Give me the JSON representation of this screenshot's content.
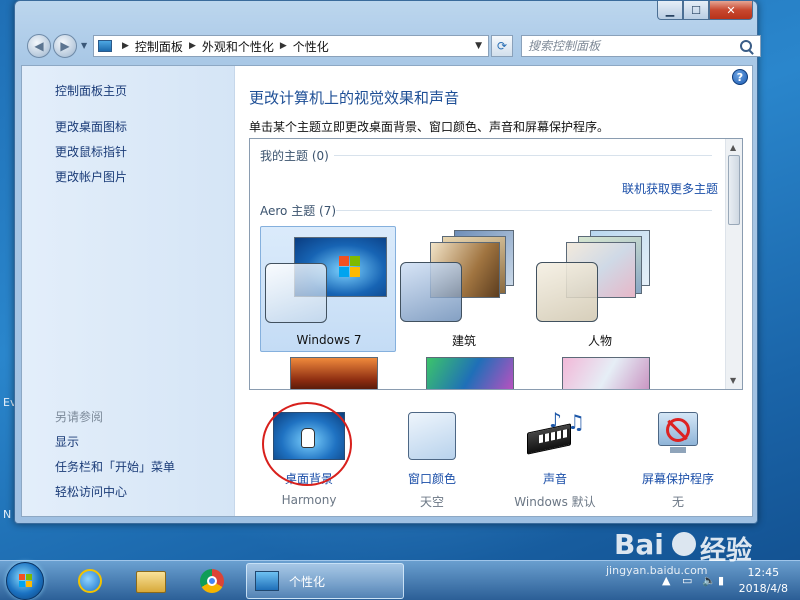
{
  "window": {
    "caption_buttons": {
      "minimize": "▁",
      "maximize": "☐",
      "close": "✕"
    }
  },
  "navbar": {
    "breadcrumbs": [
      "控制面板",
      "外观和个性化",
      "个性化"
    ],
    "search_placeholder": "搜索控制面板"
  },
  "sidebar": {
    "home": "控制面板主页",
    "links": [
      "更改桌面图标",
      "更改鼠标指针",
      "更改帐户图片"
    ],
    "see_also_title": "另请参阅",
    "see_also": [
      "显示",
      "任务栏和「开始」菜单",
      "轻松访问中心"
    ]
  },
  "main": {
    "title": "更改计算机上的视觉效果和声音",
    "description": "单击某个主题立即更改桌面背景、窗口颜色、声音和屏幕保护程序。",
    "my_themes": "我的主题 (0)",
    "more_themes_link": "联机获取更多主题",
    "aero_themes": "Aero 主题 (7)",
    "themes": [
      {
        "label": "Windows 7",
        "selected": true
      },
      {
        "label": "建筑",
        "selected": false
      },
      {
        "label": "人物",
        "selected": false
      }
    ]
  },
  "bottom": [
    {
      "label": "桌面背景",
      "sub": "Harmony",
      "icon": "desktop-background-icon"
    },
    {
      "label": "窗口颜色",
      "sub": "天空",
      "icon": "window-color-icon"
    },
    {
      "label": "声音",
      "sub": "Windows 默认",
      "icon": "sound-icon"
    },
    {
      "label": "屏幕保护程序",
      "sub": "无",
      "icon": "screensaver-icon"
    }
  ],
  "taskbar": {
    "active_task": "个性化",
    "time": "12:45",
    "date": "2018/4/8"
  },
  "desktop": {
    "edge_text_1": "Ev",
    "edge_text_2": "N"
  },
  "watermark": {
    "brand": "Bai",
    "brand2": "经验",
    "url": "jingyan.baidu.com"
  },
  "colors": {
    "link_blue": "#1b3c78",
    "title_blue": "#1e4f96",
    "annotation_red": "#d8201c"
  }
}
